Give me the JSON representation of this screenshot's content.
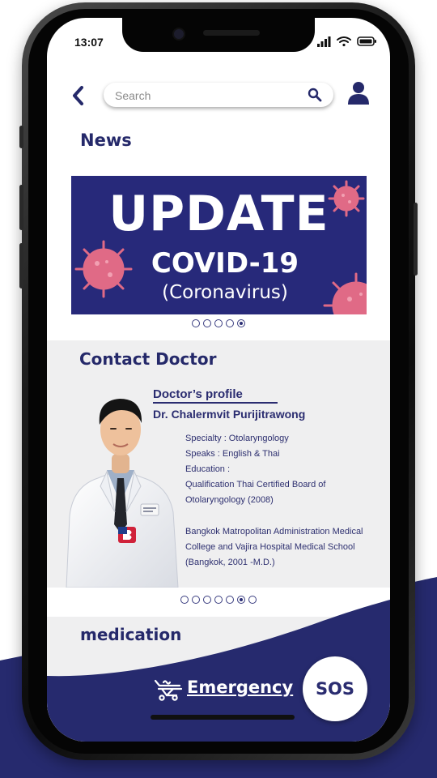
{
  "status_bar": {
    "time": "13:07"
  },
  "header": {
    "search_placeholder": "Search"
  },
  "news": {
    "title": "News",
    "banner": {
      "line1": "UPDATE",
      "line2": "COVID-19",
      "line3": "(Coronavirus)"
    },
    "carousel": {
      "count": 5,
      "active_index": 4
    }
  },
  "contact": {
    "title": "Contact Doctor",
    "profile_heading": "Doctor’s profile",
    "doctor_name": "Dr. Chalermvit Purijitrawong",
    "details": [
      "Specialty : Otolaryngology",
      "Speaks : English & Thai",
      "Education :",
      "Qualification Thai Certified Board of",
      "Otolaryngology (2008)",
      "",
      "Bangkok Matropolitan Administration Medical",
      "College and Vajira Hospital Medical School",
      "(Bangkok, 2001 -M.D.)"
    ],
    "carousel": {
      "count": 7,
      "active_index": 5
    }
  },
  "medication": {
    "title": "medication"
  },
  "emergency": {
    "label": "Emergency",
    "sos_label": "SOS"
  },
  "colors": {
    "brand_navy": "#25296a",
    "banner_bg": "#27297a",
    "virus_pink": "#e06a86",
    "panel_gray": "#efeff0"
  },
  "icons": [
    "back-arrow-icon",
    "search-icon",
    "user-icon",
    "stretcher-icon",
    "signal-icon",
    "wifi-icon",
    "battery-icon"
  ]
}
